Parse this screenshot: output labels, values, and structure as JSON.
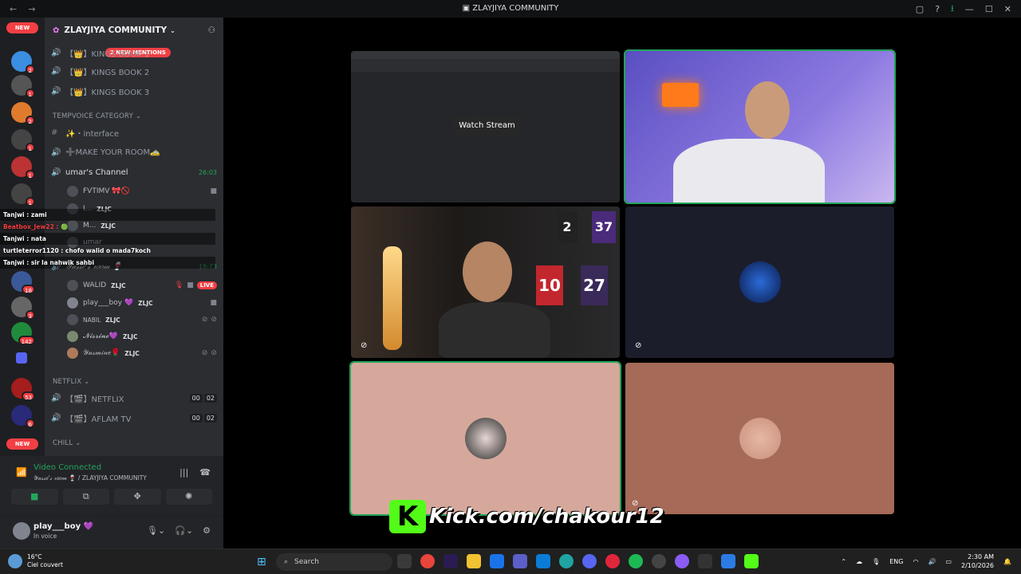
{
  "titlebar": {
    "title": "ZLAYJIYA COMMUNITY",
    "back": "←",
    "forward": "→"
  },
  "servers": {
    "new_top": "NEW",
    "new_bottom": "NEW",
    "badges": [
      "2",
      "2",
      "1",
      "2",
      "1",
      "1",
      "1",
      "18",
      "3",
      "142",
      "53",
      "6"
    ]
  },
  "guild": {
    "name": "ZLAYJIYA COMMUNITY",
    "mentions": "2 NEW MENTIONS"
  },
  "channels": [
    {
      "icon": "speaker",
      "label": "【👑】KINGS BOOK 1"
    },
    {
      "icon": "speaker",
      "label": "【👑】KINGS BOOK 2"
    },
    {
      "icon": "speaker",
      "label": "【👑】KINGS BOOK 3"
    }
  ],
  "tempvoice": {
    "category": "TEMPVOICE CATEGORY",
    "interface": "✨・interface",
    "make_room": "➕MAKE YOUR ROOM🚕",
    "umar_channel": "umar's Channel",
    "umar_time": "26:03",
    "umar_users": [
      {
        "name": "FVTIMV 🎀🚫",
        "tag": ""
      },
      {
        "name": "I...",
        "tag": "ZLJC"
      },
      {
        "name": "M...",
        "tag": "ZLJC"
      },
      {
        "name": "umar",
        "tag": ""
      }
    ],
    "yasse_channel": "𝒴𝒶𝓈𝓈𝑒'𝓈 𝓇𝑜𝑜𝓂 🍷",
    "yasse_time": "19:73",
    "yasse_users": [
      {
        "name": "WALID",
        "tag": "ZLJC",
        "live": "LIVE"
      },
      {
        "name": "play___boy 💜",
        "tag": "ZLJC"
      },
      {
        "name": "NABIL",
        "tag": "ZLJC"
      },
      {
        "name": "𝓝𝓲𝓼𝓻𝓲𝓷𝓮💜",
        "tag": "ZLJC"
      },
      {
        "name": "𝒴𝒶𝓈𝓂𝒾𝓃𝑒🌹",
        "tag": "ZLJC"
      }
    ]
  },
  "netflix": {
    "category": "NETFLIX",
    "items": [
      {
        "label": "【🎬】NETFLIX",
        "a": "00",
        "b": "02"
      },
      {
        "label": "【🎬】AFLAM TV",
        "a": "00",
        "b": "02"
      }
    ]
  },
  "chill": {
    "category": "CHILL"
  },
  "chat_overlay": [
    "Tanjwi : zami",
    "Beatbox_Jew22 : 🟢",
    "Tanjwi : nata",
    "turtleterror1120 : chofo walid o mada7koch",
    "Tanjwi : sir la nahwik sahbi"
  ],
  "voice_panel": {
    "status": "Video Connected",
    "sub": "𝒴𝒶𝓈𝓈𝑒'𝓈 𝓇𝑜𝑜𝓂 🍷 / ZLAYJIYA COMMUNITY"
  },
  "me": {
    "name": "play___boy 💜",
    "status": "In voice"
  },
  "stage": {
    "watch_stream": "Watch Stream",
    "poster_a": "2",
    "poster_b": "37",
    "poster_c": "10",
    "poster_d": "27"
  },
  "overlay": {
    "kick_text": "Kick.com/chakour12",
    "kick_logo": "K"
  },
  "taskbar": {
    "temp": "16°C",
    "weather": "Ciel couvert",
    "search": "Search",
    "lang": "ENG",
    "time": "2:30 AM",
    "date": "2/10/2026"
  },
  "colors": {
    "accent": "#5865f2",
    "green": "#23a55a",
    "red": "#f23f43",
    "kick": "#53fc18"
  }
}
